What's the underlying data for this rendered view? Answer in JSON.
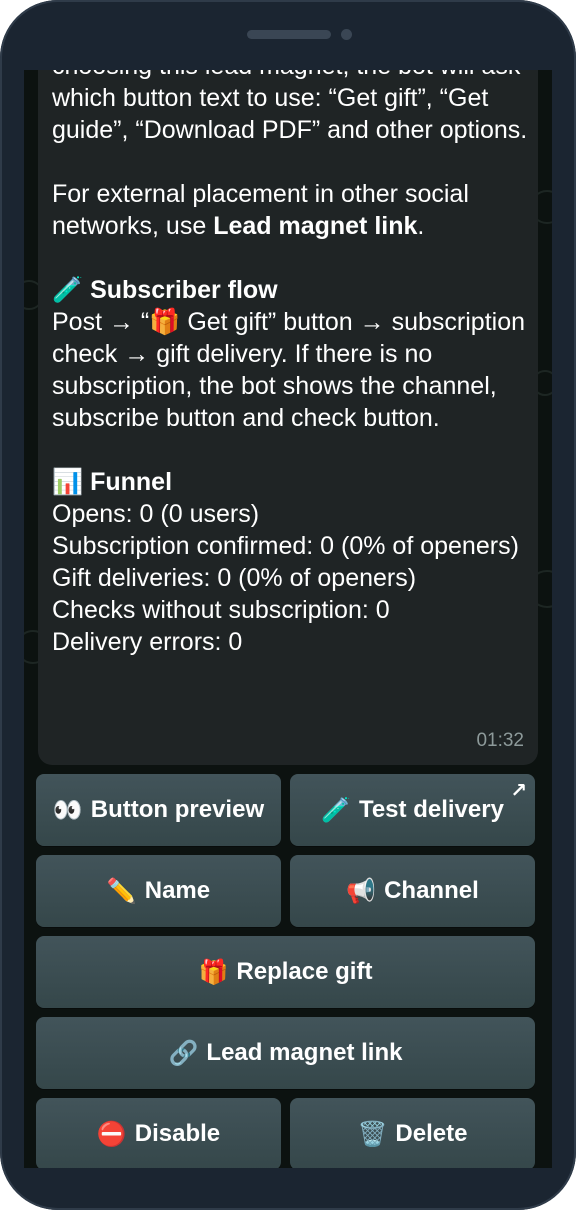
{
  "message": {
    "intro_line": "choosing this lead magnet, the bot will ask which button text to use: “Get gift”, “Get guide”, “Download PDF” and other options.",
    "external_text": "For external placement in other social networks, use ",
    "external_bold": "Lead magnet link",
    "external_end": ".",
    "flow_icon": "🧪",
    "flow_title": "Subscriber flow",
    "flow_pre": "Post → “",
    "flow_gift_icon": "🎁",
    "flow_post": " Get gift” button → subscription check → gift delivery. If there is no subscription, the bot shows the channel, subscribe button and check button.",
    "funnel_icon": "📊",
    "funnel_title": "Funnel",
    "opens": "Opens: 0 (0 users)",
    "subscription_confirmed": "Subscription confirmed: 0 (0% of openers)",
    "gift_deliveries": "Gift deliveries: 0 (0% of openers)",
    "checks_without_subscription": "Checks without subscription: 0",
    "delivery_errors": "Delivery errors: 0",
    "time": "01:32"
  },
  "buttons": {
    "button_preview": {
      "icon": "👀",
      "label": "Button preview"
    },
    "test_delivery": {
      "icon": "🧪",
      "label": "Test delivery",
      "corner": "↗"
    },
    "name": {
      "icon": "✏️",
      "label": "Name"
    },
    "channel": {
      "icon": "📢",
      "label": "Channel"
    },
    "replace_gift": {
      "icon": "🎁",
      "label": "Replace gift"
    },
    "lead_magnet_link": {
      "icon": "🔗",
      "label": "Lead magnet link"
    },
    "disable": {
      "icon": "⛔",
      "label": "Disable"
    },
    "delete": {
      "icon": "🗑️",
      "label": "Delete"
    }
  }
}
